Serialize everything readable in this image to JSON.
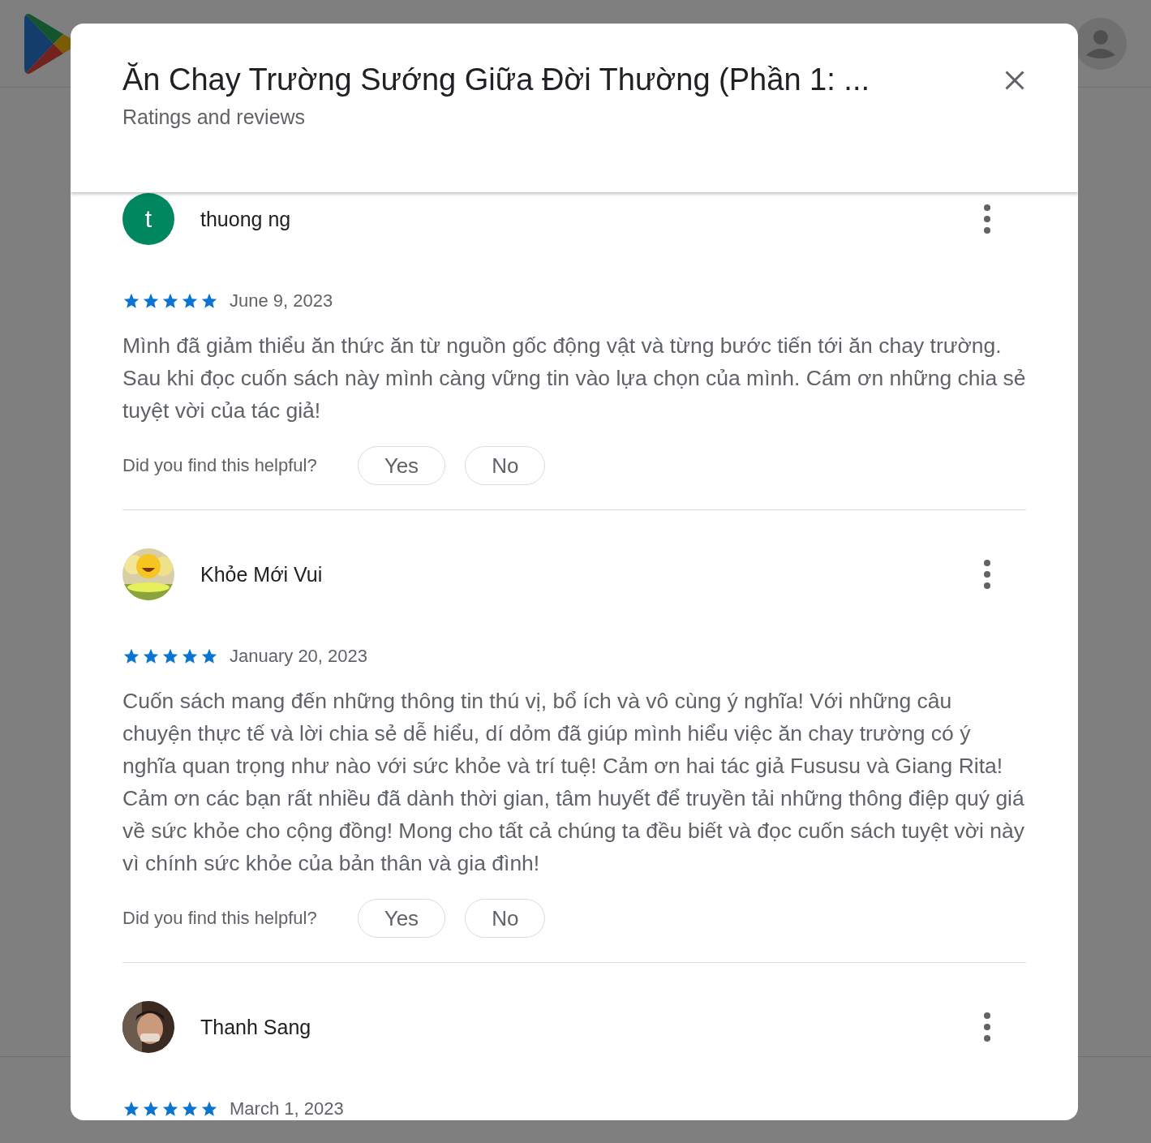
{
  "dialog": {
    "title": "Ăn Chay Trường Sướng Giữa Đời Thường (Phần 1: ...",
    "subtitle": "Ratings and reviews",
    "reviews": [
      {
        "name": "thuong ng",
        "avatar": {
          "kind": "letter",
          "letter": "t",
          "color": "#01875f"
        },
        "stars": 5,
        "date": "June 9, 2023",
        "text": "Mình đã giảm thiểu ăn thức ăn từ nguồn gốc động vật và từng bước tiến tới ăn chay trường. Sau khi đọc cuốn sách này mình càng vững tin vào lựa chọn của mình. Cám ơn những chia sẻ tuyệt vời của tác giả!",
        "helpful": {
          "question": "Did you find this helpful?",
          "yes": "Yes",
          "no": "No"
        }
      },
      {
        "name": "Khỏe Mới Vui",
        "stars": 5,
        "date": "January 20, 2023",
        "text": "Cuốn sách mang đến những thông tin thú vị, bổ ích và vô cùng ý nghĩa! Với những câu chuyện thực tế và lời chia sẻ dễ hiểu, dí dỏm đã giúp mình hiểu việc ăn chay trường có ý nghĩa quan trọng như nào với sức khỏe và trí tuệ! Cảm ơn hai tác giả Fususu và Giang Rita! Cảm ơn các bạn rất nhiều đã dành thời gian, tâm huyết để truyền tải những thông điệp quý giá về sức khỏe cho cộng đồng! Mong cho tất cả chúng ta đều biết và đọc cuốn sách tuyệt vời này vì chính sức khỏe của bản thân và gia đình!",
        "helpful": {
          "question": "Did you find this helpful?",
          "yes": "Yes",
          "no": "No"
        }
      },
      {
        "name": "Thanh Sang",
        "stars": 5,
        "date": "March 1, 2023"
      }
    ]
  }
}
